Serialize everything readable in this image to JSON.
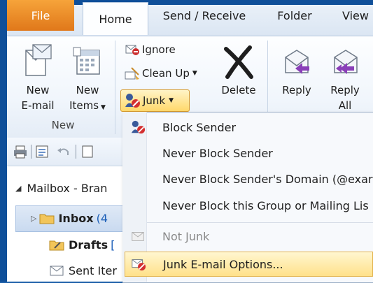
{
  "tabs": {
    "file": "File",
    "home": "Home",
    "send_receive": "Send / Receive",
    "folder": "Folder",
    "view": "View"
  },
  "ribbon": {
    "new_group": {
      "new_email_line1": "New",
      "new_email_line2": "E-mail",
      "new_items_line1": "New",
      "new_items_line2": "Items",
      "label": "New"
    },
    "delete_group": {
      "ignore": "Ignore",
      "clean_up": "Clean Up",
      "junk": "Junk",
      "delete": "Delete"
    },
    "respond_group": {
      "reply": "Reply",
      "reply_all_line1": "Reply",
      "reply_all_line2": "All"
    }
  },
  "folder_tree": {
    "mailbox": "Mailbox - Bran",
    "inbox": "Inbox",
    "inbox_count": "(4",
    "drafts": "Drafts",
    "drafts_count": "[",
    "sent": "Sent Iter"
  },
  "junk_menu": {
    "items": [
      {
        "label": "Block Sender",
        "enabled": true
      },
      {
        "label": "Never Block Sender",
        "enabled": true
      },
      {
        "label": "Never Block Sender's Domain (@exar",
        "enabled": true
      },
      {
        "label": "Never Block this Group or Mailing Lis",
        "enabled": true
      },
      {
        "label": "Not Junk",
        "enabled": false
      },
      {
        "label": "Junk E-mail Options...",
        "enabled": true,
        "highlighted": true
      }
    ]
  },
  "colors": {
    "file_tab": "#e8861f",
    "window_frame": "#1b5ea8",
    "highlight": "#ffe18a",
    "reply_arrow": "#8a3fb8"
  }
}
